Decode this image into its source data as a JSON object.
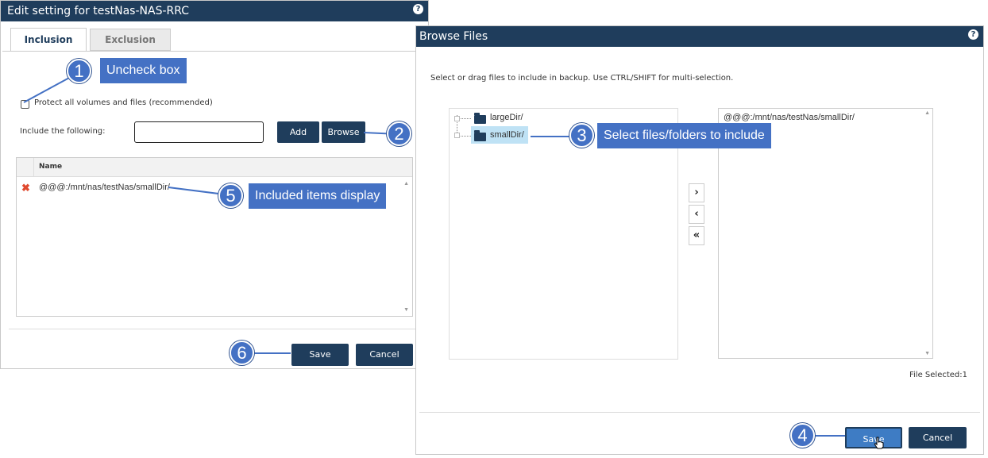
{
  "left_dialog": {
    "title": "Edit setting for testNas-NAS-RRC",
    "tabs": [
      "Inclusion",
      "Exclusion"
    ],
    "protect_label": "Protect all volumes and files (recommended)",
    "include_label": "Include the following:",
    "include_value": "",
    "add_label": "Add",
    "browse_label": "Browse",
    "grid_header": "Name",
    "rows": [
      "@@@:/mnt/nas/testNas/smallDir/"
    ],
    "save_label": "Save",
    "cancel_label": "Cancel"
  },
  "right_dialog": {
    "title": "Browse Files",
    "hint": "Select or drag files to include in backup. Use CTRL/SHIFT for multi-selection.",
    "tree": [
      "largeDir/",
      "smallDir/"
    ],
    "selected": [
      "@@@:/mnt/nas/testNas/smallDir/"
    ],
    "move_buttons": [
      "›",
      "‹",
      "«"
    ],
    "file_count": "File Selected:1",
    "save_label": "Save",
    "cancel_label": "Cancel"
  },
  "callouts": [
    {
      "n": "1",
      "text": "Uncheck box"
    },
    {
      "n": "2",
      "text": ""
    },
    {
      "n": "3",
      "text": "Select files/folders to include"
    },
    {
      "n": "4",
      "text": ""
    },
    {
      "n": "5",
      "text": "Included items display"
    },
    {
      "n": "6",
      "text": ""
    }
  ],
  "colors": {
    "titlebar": "#1f3d5c",
    "button": "#1f3d5c",
    "callout": "#4471c4",
    "selection": "#bfe2f5",
    "delete": "#e04a2f"
  }
}
